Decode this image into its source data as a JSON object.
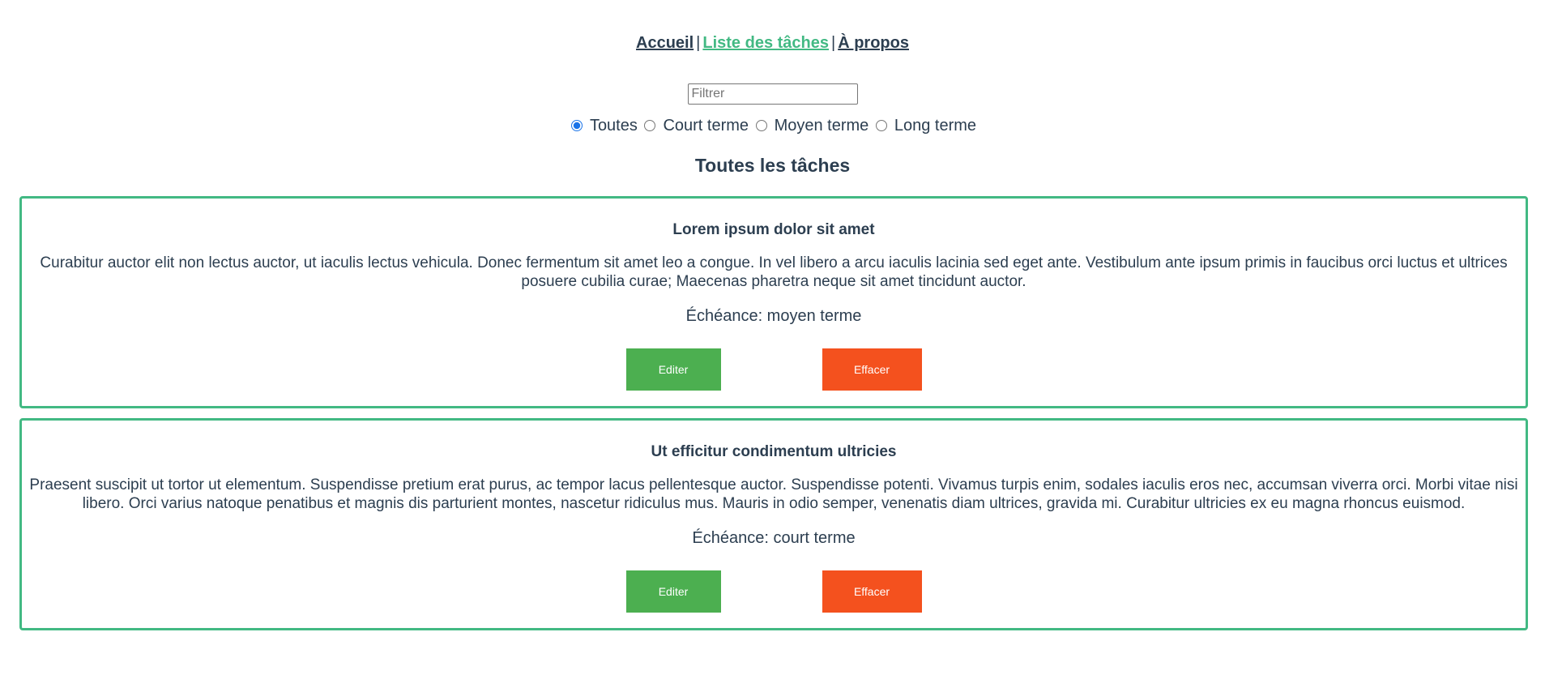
{
  "nav": {
    "home": "Accueil",
    "tasks": "Liste des tâches",
    "about": "À propos",
    "separator": "|"
  },
  "filter": {
    "placeholder": "Filtrer",
    "value": ""
  },
  "radios": {
    "selected": "Toutes",
    "options": [
      "Toutes",
      "Court terme",
      "Moyen terme",
      "Long terme"
    ]
  },
  "list_title": "Toutes les tâches",
  "tasks": [
    {
      "title": "Lorem ipsum dolor sit amet",
      "description": "Curabitur auctor elit non lectus auctor, ut iaculis lectus vehicula. Donec fermentum sit amet leo a congue. In vel libero a arcu iaculis lacinia sed eget ante. Vestibulum ante ipsum primis in faucibus orci luctus et ultrices posuere cubilia curae; Maecenas pharetra neque sit amet tincidunt auctor.",
      "due": "Échéance: moyen terme",
      "edit_label": "Editer",
      "delete_label": "Effacer"
    },
    {
      "title": "Ut efficitur condimentum ultricies",
      "description": "Praesent suscipit ut tortor ut elementum. Suspendisse pretium erat purus, ac tempor lacus pellentesque auctor. Suspendisse potenti. Vivamus turpis enim, sodales iaculis eros nec, accumsan viverra orci. Morbi vitae nisi libero. Orci varius natoque penatibus et magnis dis parturient montes, nascetur ridiculus mus. Mauris in odio semper, venenatis diam ultrices, gravida mi. Curabitur ultricies ex eu magna rhoncus euismod.",
      "due": "Échéance: court terme",
      "edit_label": "Editer",
      "delete_label": "Effacer"
    }
  ],
  "colors": {
    "accent": "#42b983",
    "text": "#2c3e50",
    "edit": "#4caf50",
    "delete": "#f4511e"
  }
}
